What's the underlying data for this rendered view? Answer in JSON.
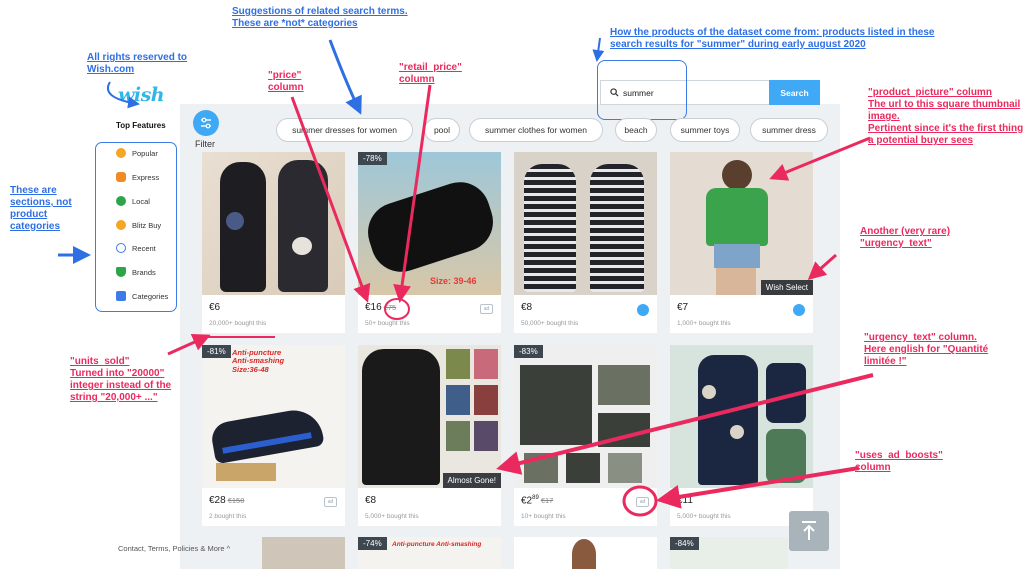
{
  "app": {
    "logo": "wish",
    "search": {
      "value": "summer",
      "button": "Search"
    },
    "filter_label": "Filter",
    "top_features_title": "Top Features",
    "sections": [
      {
        "label": "Popular",
        "icon": "star-icon",
        "color": "#f5a623"
      },
      {
        "label": "Express",
        "icon": "express-icon",
        "color": "#f08a24"
      },
      {
        "label": "Local",
        "icon": "local-pin-icon",
        "color": "#2ca54a"
      },
      {
        "label": "Blitz Buy",
        "icon": "blitz-icon",
        "color": "#f5a623"
      },
      {
        "label": "Recent",
        "icon": "clock-icon",
        "color": "#3d7be8"
      },
      {
        "label": "Brands",
        "icon": "shield-icon",
        "color": "#2ca54a"
      },
      {
        "label": "Categories",
        "icon": "grid-icon",
        "color": "#3d7be8"
      }
    ],
    "chips": [
      "summer dresses for women",
      "pool",
      "summer clothes for women",
      "beach",
      "summer toys",
      "summer dress"
    ],
    "products_row1": [
      {
        "price": "€6",
        "retail": "",
        "sold": "20,000+ bought this",
        "badge": "",
        "urgency": "",
        "mark": "",
        "colors": [
          "#e9dfd2",
          "#1d1d22",
          "#4a5a86"
        ]
      },
      {
        "price": "€16",
        "retail": "€75",
        "sold": "50+ bought this",
        "badge": "-78%",
        "urgency": "",
        "mark": "ad",
        "overlay": "Size: 39-46",
        "colors": [
          "#9ec7d9",
          "#111111",
          "#c9b08f"
        ]
      },
      {
        "price": "€8",
        "retail": "",
        "sold": "50,000+ bought this",
        "badge": "",
        "urgency": "",
        "mark": "verified",
        "colors": [
          "#d8d2c8",
          "#23232a",
          "#e8e8ea"
        ]
      },
      {
        "price": "€7",
        "retail": "",
        "sold": "1,000+ bought this",
        "badge": "",
        "urgency": "Wish Select",
        "mark": "verified",
        "colors": [
          "#e4dcd2",
          "#3aa34c",
          "#7fa4c9"
        ]
      }
    ],
    "products_row2": [
      {
        "price": "€28",
        "retail": "€150",
        "sold": "2 bought this",
        "badge": "-81%",
        "urgency": "",
        "mark": "ad",
        "overlay": "Anti-puncture Anti-smashing Size:36-48",
        "colors": [
          "#f5f3f0",
          "#1c2230",
          "#2b5fd0"
        ]
      },
      {
        "price": "€8",
        "retail": "",
        "sold": "5,000+ bought this",
        "badge": "",
        "urgency": "Almost Gone!",
        "mark": "",
        "colors": [
          "#eae6e0",
          "#1a1a1a",
          "#7b8a4c"
        ]
      },
      {
        "price": "€2",
        "price_cents": "89",
        "retail": "€17",
        "sold": "10+ bought this",
        "badge": "-83%",
        "urgency": "",
        "mark": "ad",
        "colors": [
          "#efefef",
          "#3b3f3a",
          "#6a7062"
        ]
      },
      {
        "price": "€11",
        "retail": "",
        "sold": "5,000+ bought this",
        "badge": "",
        "urgency": "",
        "mark": "",
        "colors": [
          "#d6e4dd",
          "#1b2740",
          "#4f7a57"
        ]
      }
    ],
    "products_row3_badges": [
      "-74%",
      "-84%"
    ],
    "row3_overlay": "Anti-puncture Anti-smashing",
    "footer": "Contact, Terms, Policies & More ^"
  },
  "annotations": {
    "rights": "All rights reserved to Wish.com",
    "suggestions": "Suggestions of related search terms. These are *not* categories",
    "products_source": "How the products of the dataset come from: products listed in these search results for \"summer\" during early august 2020",
    "price": "\"price\" column",
    "retail_price": "\"retail_price\" column",
    "product_picture": "\"product_picture\" column\nThe url to this square thumbnail image.\nPertinent since it's the first thing a potential buyer sees",
    "sections": "These are sections, not product categories",
    "another_urgency": "Another (very rare) \"urgency_text\"",
    "urgency_text": "\"urgency_text\" column.\nHere english for \"Quantité limitée !\"",
    "units_sold": "\"units_sold\"\nTurned into \"20000\" integer instead of the string \"20,000+ ...\"",
    "uses_ad_boosts": "\"uses_ad_boosts\" column"
  }
}
